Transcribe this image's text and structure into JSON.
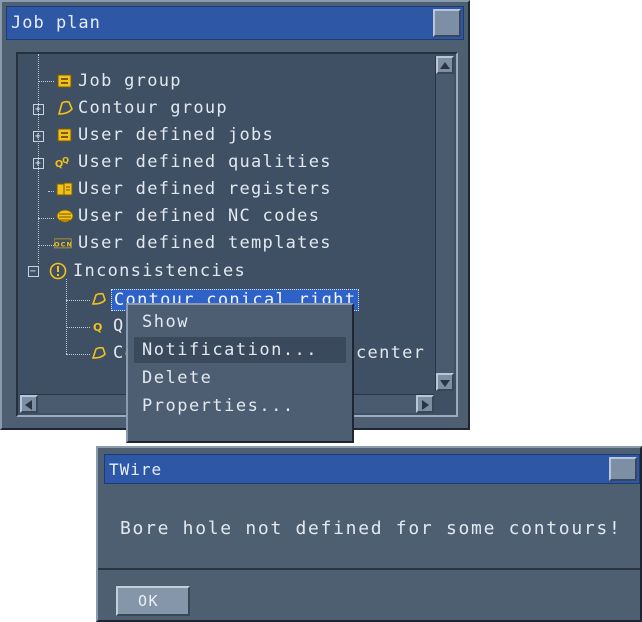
{
  "window": {
    "title": "Job plan"
  },
  "tree": {
    "items": [
      {
        "label": "Job group",
        "icon": "job-group-icon"
      },
      {
        "label": "Contour group",
        "icon": "contour-icon"
      },
      {
        "label": "User defined jobs",
        "icon": "jobs-icon"
      },
      {
        "label": "User defined qualities",
        "icon": "qualities-icon"
      },
      {
        "label": "User defined registers",
        "icon": "registers-icon"
      },
      {
        "label": "User defined NC codes",
        "icon": "nc-codes-icon"
      },
      {
        "label": "User defined templates",
        "icon": "templates-icon"
      },
      {
        "label": "Inconsistencies",
        "icon": "warning-icon"
      },
      {
        "label": "Contour conical right",
        "icon": "contour-icon"
      },
      {
        "label": "Qu",
        "icon": "quality-icon"
      },
      {
        "label": "Co",
        "icon": "contour-icon"
      }
    ],
    "overflow_text": "center"
  },
  "context_menu": {
    "items": [
      "Show",
      "Notification...",
      "Delete",
      "Properties..."
    ]
  },
  "dialog": {
    "title": "TWire",
    "message": "Bore hole not defined for some contours!",
    "ok_label": "OK"
  },
  "colors": {
    "panel": "#4e5f72",
    "titlebar": "#2e57a6",
    "selection": "#2f62c8",
    "icon_yellow": "#f2c21a"
  }
}
